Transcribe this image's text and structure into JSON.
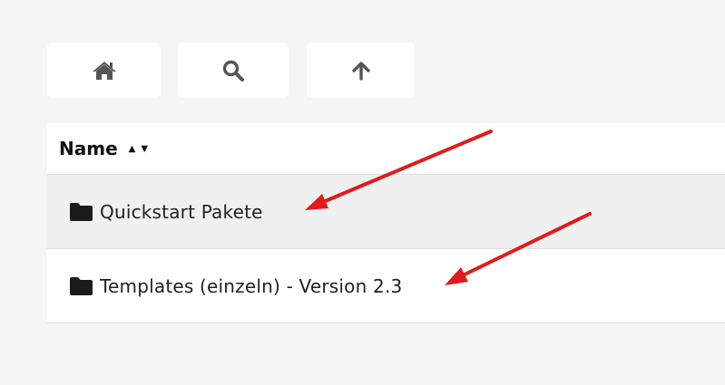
{
  "toolbar": {
    "home_icon": "home-icon",
    "search_icon": "search-icon",
    "up_icon": "arrow-up-icon"
  },
  "table": {
    "column_header": "Name",
    "sort_asc_glyph": "▲",
    "sort_desc_glyph": "▼",
    "rows": [
      {
        "label": "Quickstart Pakete",
        "icon": "folder-icon"
      },
      {
        "label": "Templates (einzeln) - Version 2.3",
        "icon": "folder-icon"
      }
    ]
  },
  "colors": {
    "background": "#f5f5f5",
    "panel": "#ffffff",
    "row_hover": "#f0f0f0",
    "annotation_arrow": "#e01b1b"
  }
}
